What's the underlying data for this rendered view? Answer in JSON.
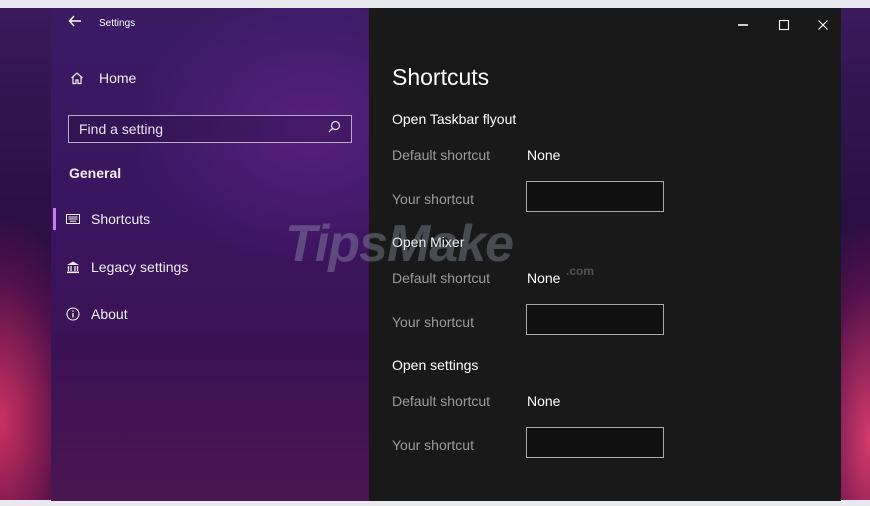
{
  "window": {
    "title": "Settings",
    "back_icon": "arrow-left-icon"
  },
  "sidebar": {
    "home_label": "Home",
    "search_placeholder": "Find a setting",
    "section_heading": "General",
    "items": [
      {
        "label": "Shortcuts",
        "icon": "keyboard-icon",
        "active": true
      },
      {
        "label": "Legacy settings",
        "icon": "bank-icon",
        "active": false
      },
      {
        "label": "About",
        "icon": "info-icon",
        "active": false
      }
    ]
  },
  "main": {
    "title": "Shortcuts",
    "groups": [
      {
        "title": "Open Taskbar flyout",
        "default_label": "Default shortcut",
        "default_value": "None",
        "your_label": "Your shortcut",
        "your_value": ""
      },
      {
        "title": "Open Mixer",
        "default_label": "Default shortcut",
        "default_value": "None",
        "your_label": "Your shortcut",
        "your_value": ""
      },
      {
        "title": "Open settings",
        "default_label": "Default shortcut",
        "default_value": "None",
        "your_label": "Your shortcut",
        "your_value": ""
      }
    ]
  },
  "watermark": {
    "text": "TipsMake",
    "suffix": ".com"
  },
  "colors": {
    "accent": "#c67cf0",
    "content_bg": "#191919",
    "sidebar_bg": "#3a1560"
  }
}
